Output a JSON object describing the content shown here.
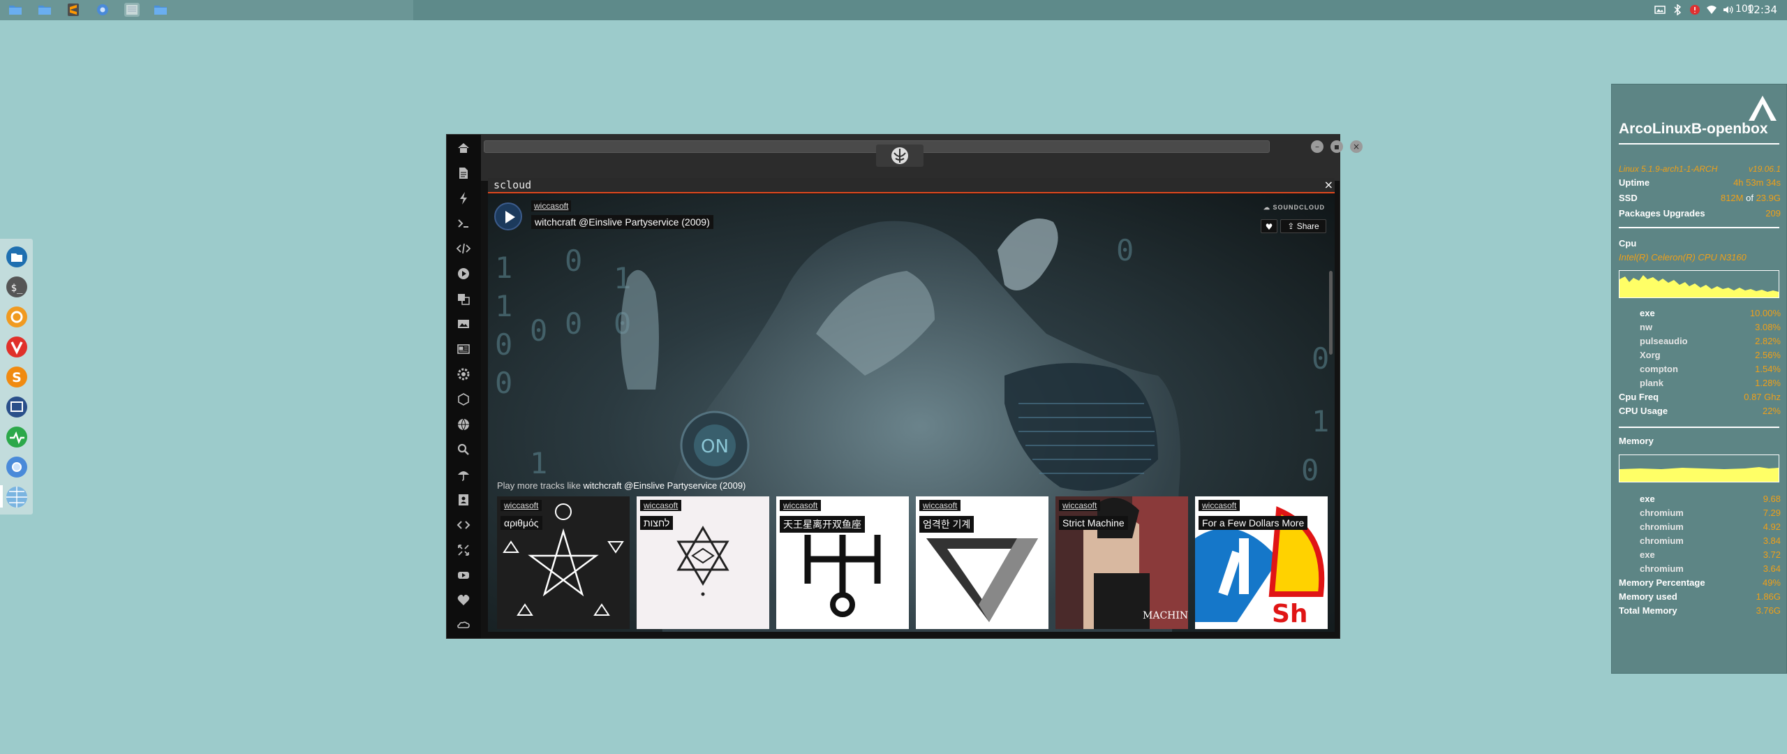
{
  "top_panel": {
    "clock": "12:34",
    "taskbar_icons": [
      "folder-icon",
      "folder-icon",
      "sublime-text-icon",
      "chromium-icon",
      "terminal-icon",
      "folder-icon"
    ],
    "tray_icons": [
      "image-icon",
      "bluetooth-icon",
      "red-alert-icon",
      "wifi-icon",
      "volume-icon"
    ],
    "volume": "100"
  },
  "dock": {
    "apps": [
      "file-manager",
      "terminal",
      "ubuntu-like",
      "vivaldi",
      "sublime-text",
      "screenshot",
      "system-monitor",
      "chromium",
      "network-globe"
    ]
  },
  "window": {
    "sidebar_icons": [
      "home-icon",
      "document-icon",
      "lightning-icon",
      "terminal-prompt-icon",
      "code-icon",
      "play-icon",
      "translate-icon",
      "image-icon",
      "news-icon",
      "settings-cog-icon",
      "hexagon-icon",
      "globe-icon",
      "search-icon",
      "umbrella-icon",
      "contact-icon",
      "code-tags-icon",
      "expand-icon",
      "youtube-icon",
      "heart-icon",
      "soundcloud-icon"
    ],
    "panel_title": "scloud",
    "panel_close": "×"
  },
  "player": {
    "username": "wiccasoft",
    "track_title": "witchcraft @Einslive Partyservice (2009)",
    "brand": "SOUNDCLOUD",
    "share_label": "Share",
    "more_prefix": "Play more tracks like ",
    "more_track": "witchcraft @Einslive Partyservice (2009)",
    "related": [
      {
        "user": "wiccasoft",
        "title": "αριθμός"
      },
      {
        "user": "wiccasoft",
        "title": "לחצות"
      },
      {
        "user": "wiccasoft",
        "title": "天王星离开双鱼座"
      },
      {
        "user": "wiccasoft",
        "title": "엄격한 기계"
      },
      {
        "user": "wiccasoft",
        "title": "Strict Machine"
      },
      {
        "user": "wiccasoft",
        "title": "For a Few Dollars More"
      }
    ]
  },
  "conky": {
    "hostname": "ArcoLinuxB-openbox",
    "kernel": "Linux 5.1.9-arch1-1-ARCH",
    "version": "v19.06.1",
    "uptime_label": "Uptime",
    "uptime_value": "4h 53m 34s",
    "ssd_label": "SSD",
    "ssd_used": "812M",
    "ssd_of": " of ",
    "ssd_total": "23.9G",
    "packages_label": "Packages Upgrades",
    "packages_value": "209",
    "cpu_section": "Cpu",
    "cpu_model": "Intel(R) Celeron(R) CPU  N3160",
    "cpu_processes": [
      {
        "name": "exe",
        "value": "10.00%"
      },
      {
        "name": "nw",
        "value": "3.08%"
      },
      {
        "name": "pulseaudio",
        "value": "2.82%"
      },
      {
        "name": "Xorg",
        "value": "2.56%"
      },
      {
        "name": "compton",
        "value": "1.54%"
      },
      {
        "name": "plank",
        "value": "1.28%"
      }
    ],
    "cpu_freq_label": "Cpu Freq",
    "cpu_freq_value": "0.87 Ghz",
    "cpu_usage_label": "CPU Usage",
    "cpu_usage_value": "22%",
    "memory_section": "Memory",
    "mem_processes": [
      {
        "name": "exe",
        "value": "9.68"
      },
      {
        "name": "chromium",
        "value": "7.29"
      },
      {
        "name": "chromium",
        "value": "4.92"
      },
      {
        "name": "chromium",
        "value": "3.84"
      },
      {
        "name": "exe",
        "value": "3.72"
      },
      {
        "name": "chromium",
        "value": "3.64"
      }
    ],
    "mem_pct_label": "Memory Percentage",
    "mem_pct_value": "49%",
    "mem_used_label": "Memory used",
    "mem_used_value": "1.86G",
    "mem_total_label": "Total Memory",
    "mem_total_value": "3.76G"
  },
  "colors": {
    "desktop": "#9ccbcb",
    "conky_accent": "#f0a018",
    "panel_accent": "#e0491f",
    "graph_fill": "#ffff66"
  }
}
